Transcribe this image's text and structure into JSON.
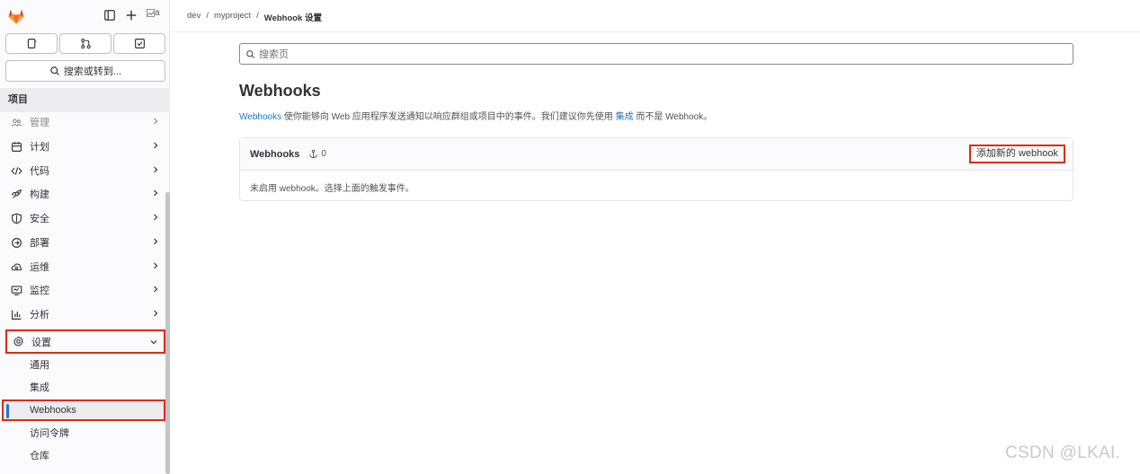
{
  "topbar": {
    "avatar_alt": "a"
  },
  "quick_actions": [
    {
      "name": "issues"
    },
    {
      "name": "merge-requests"
    },
    {
      "name": "todos"
    }
  ],
  "sidebar": {
    "search_label": "搜索或转到...",
    "section_title": "项目",
    "items": [
      {
        "label": "管理",
        "icon": "users-icon",
        "faded": true
      },
      {
        "label": "计划",
        "icon": "calendar-icon"
      },
      {
        "label": "代码",
        "icon": "code-icon"
      },
      {
        "label": "构建",
        "icon": "rocket-icon"
      },
      {
        "label": "安全",
        "icon": "shield-icon"
      },
      {
        "label": "部署",
        "icon": "deploy-icon"
      },
      {
        "label": "运维",
        "icon": "cloud-gear-icon"
      },
      {
        "label": "监控",
        "icon": "monitor-icon"
      },
      {
        "label": "分析",
        "icon": "chart-icon"
      },
      {
        "label": "设置",
        "icon": "gear-icon",
        "expanded": true
      }
    ],
    "sub_items": [
      {
        "label": "通用"
      },
      {
        "label": "集成"
      },
      {
        "label": "Webhooks",
        "current": true
      },
      {
        "label": "访问令牌"
      },
      {
        "label": "仓库"
      }
    ]
  },
  "breadcrumb": {
    "items": [
      "dev",
      "myproject",
      "Webhook 设置"
    ]
  },
  "page": {
    "search_placeholder": "搜索页",
    "title": "Webhooks",
    "desc_link1": "Webhooks",
    "desc_text1": " 使你能够向 Web 应用程序发送通知以响应群组或项目中的事件。我们建议你先使用 ",
    "desc_link2": "集成",
    "desc_text2": " 而不是 Webhook。"
  },
  "card": {
    "header": "Webhooks",
    "count": "0",
    "add_label": "添加新的 webhook",
    "empty_text": "未启用 webhook。选择上面的触发事件。"
  },
  "watermark": "CSDN @LKAI."
}
